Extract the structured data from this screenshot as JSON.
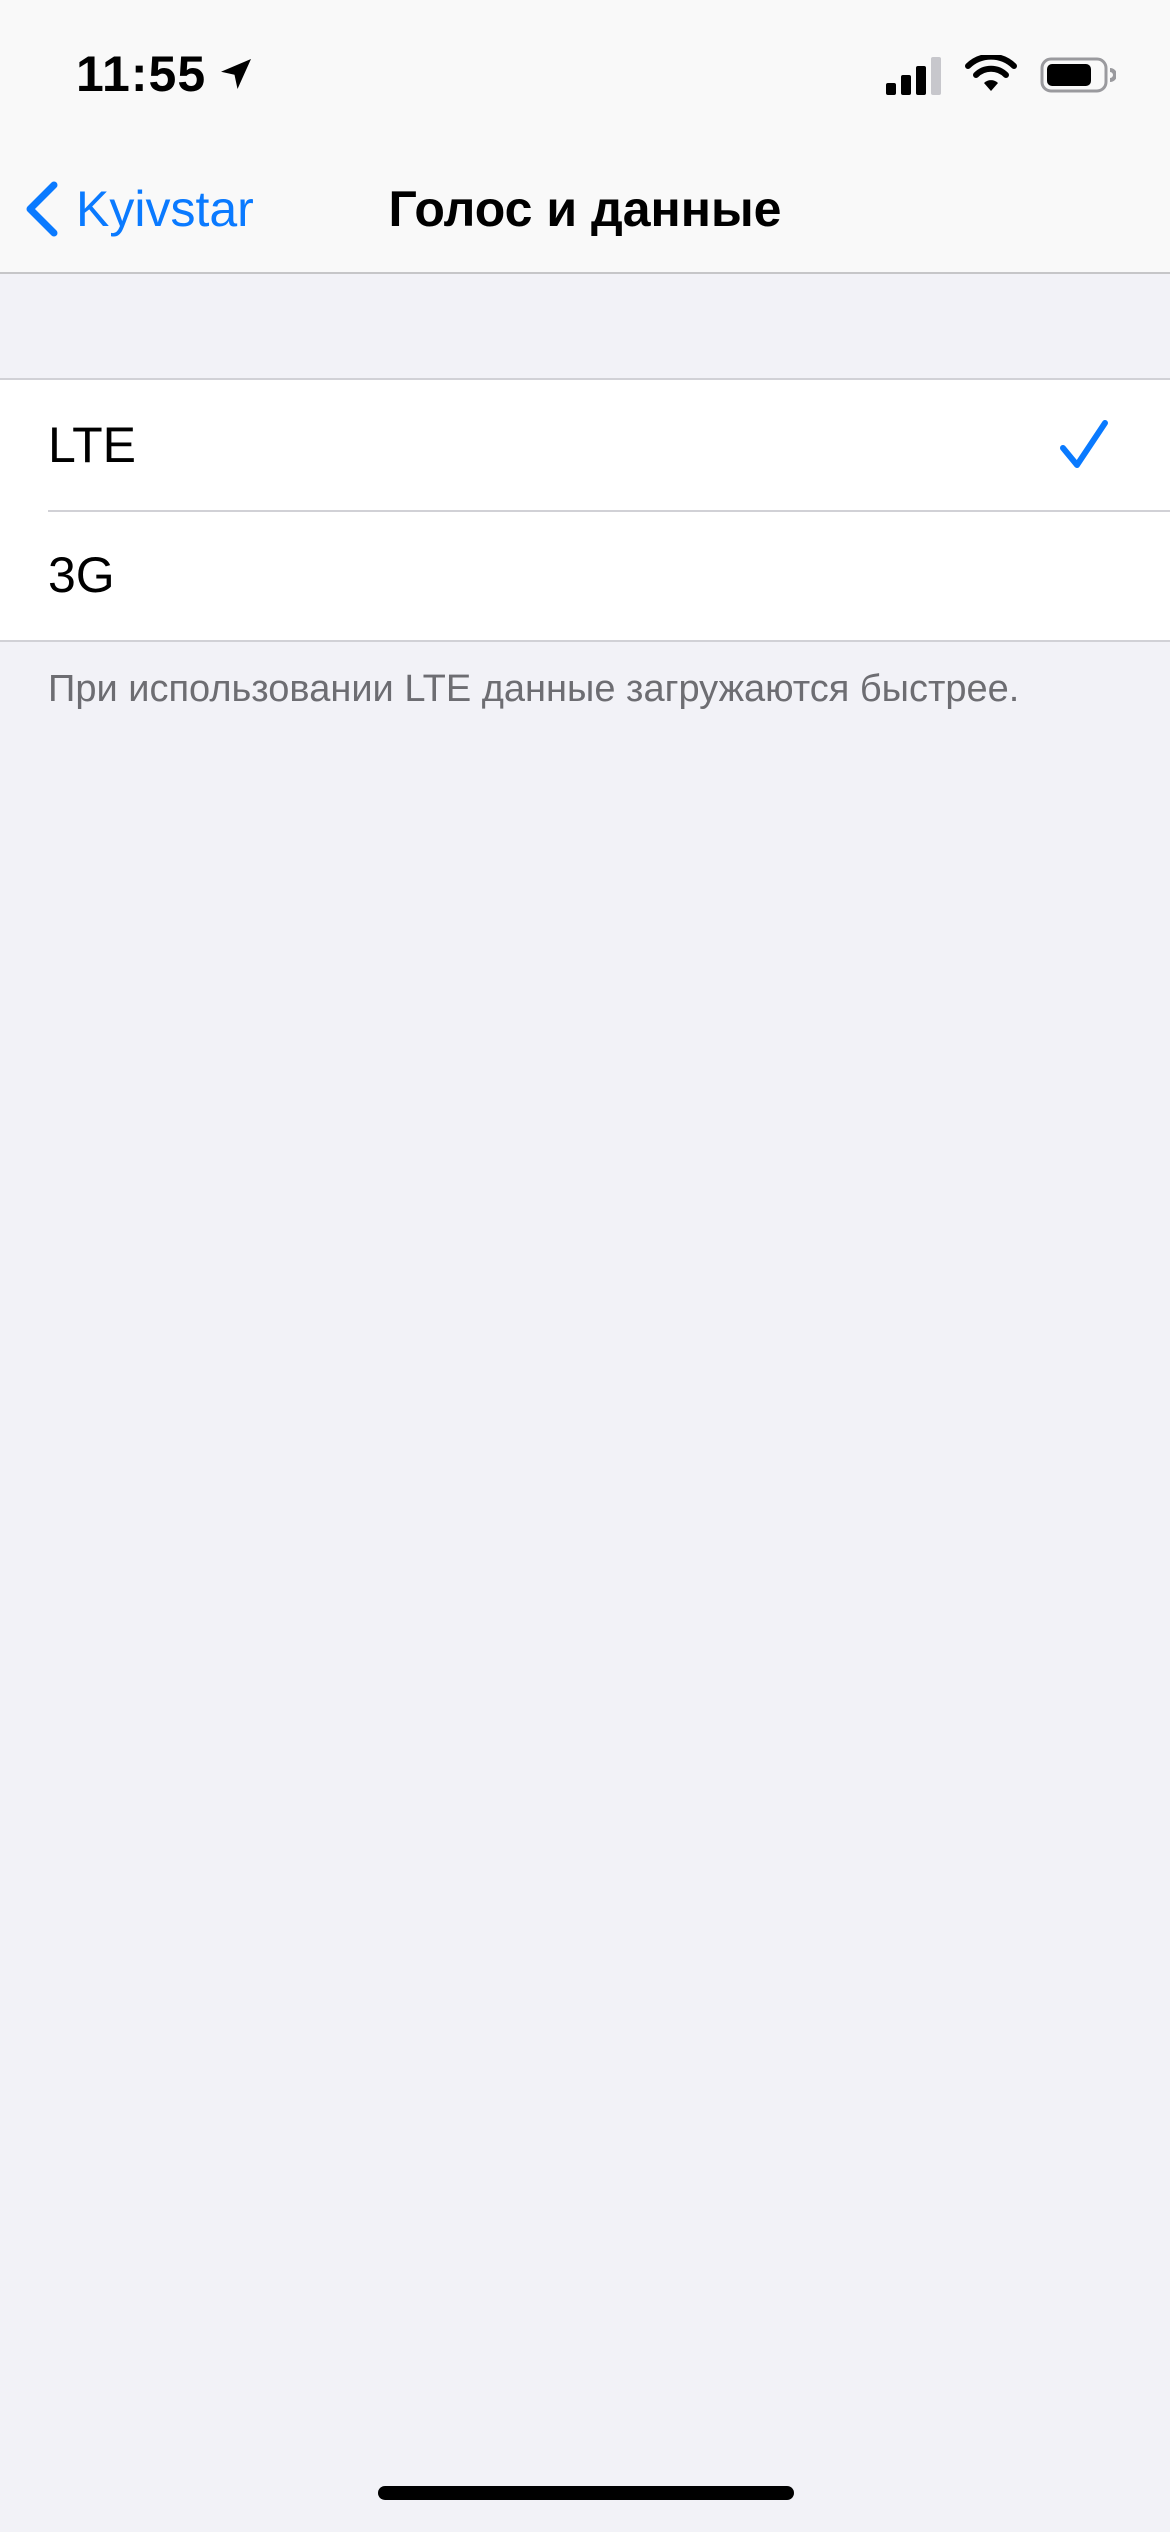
{
  "status_bar": {
    "time": "11:55",
    "icons": [
      "location-arrow-icon",
      "cellular-signal-icon",
      "wifi-icon",
      "battery-icon"
    ]
  },
  "nav": {
    "back_label": "Kyivstar",
    "title": "Голос и данные"
  },
  "options": {
    "items": [
      {
        "label": "LTE",
        "selected": true
      },
      {
        "label": "3G",
        "selected": false
      }
    ]
  },
  "footer_note": "При использовании LTE данные загружаются быстрее.",
  "colors": {
    "accent": "#0a7aff",
    "background": "#f2f2f7",
    "cell": "#ffffff",
    "secondary_text": "#6d6d72"
  }
}
